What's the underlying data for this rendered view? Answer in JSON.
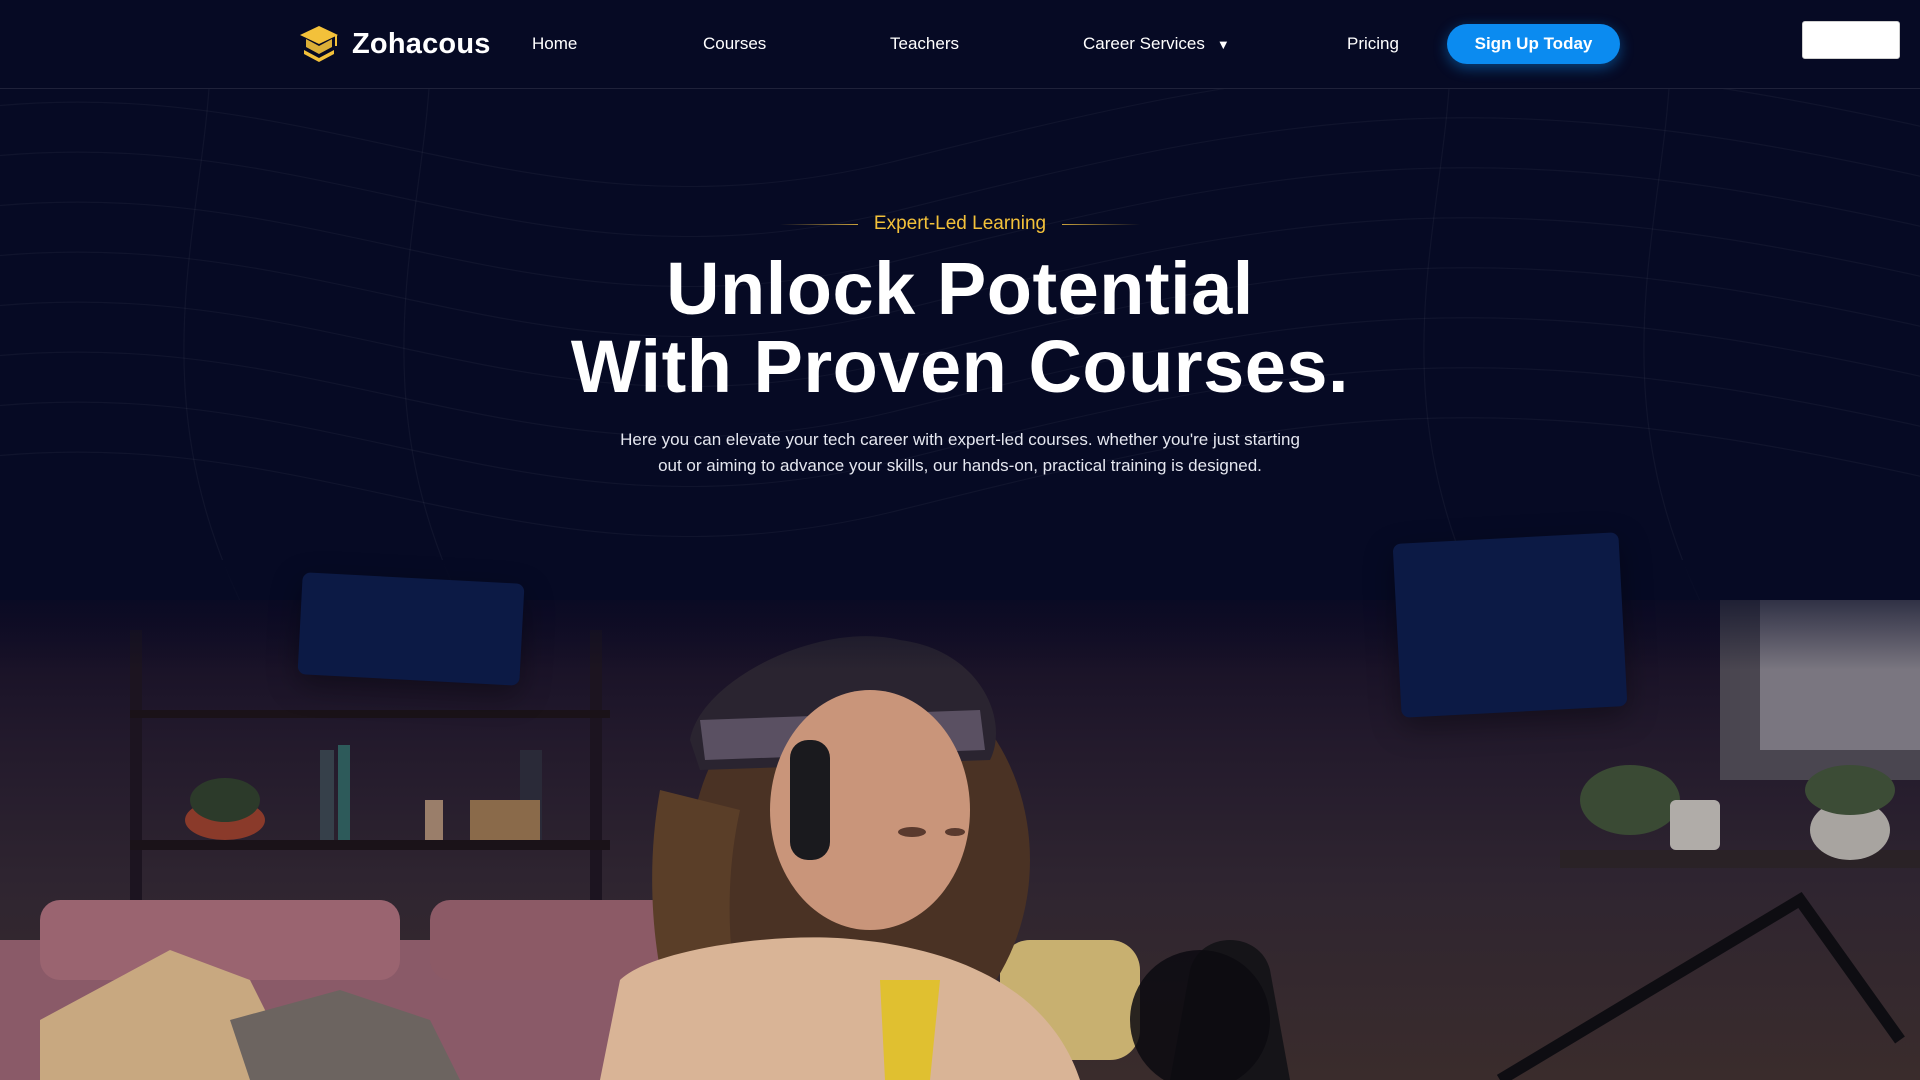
{
  "brand": {
    "name": "Zohacous",
    "logo_icon": "graduation-cap-icon",
    "accent": "#f3c13a"
  },
  "nav": {
    "items": [
      {
        "label": "Home"
      },
      {
        "label": "Courses"
      },
      {
        "label": "Teachers"
      },
      {
        "label": "Career Services",
        "has_dropdown": true,
        "caret": "▼"
      },
      {
        "label": "Pricing"
      }
    ],
    "cta_label": "Sign Up Today",
    "cta_color": "#0b8bf0"
  },
  "hero": {
    "eyebrow": "Expert-Led Learning",
    "headline_line1": "Unlock Potential",
    "headline_line2": "With Proven Courses.",
    "subtext_line1": "Here you can elevate your tech career with expert-led courses. whether you're just starting",
    "subtext_line2": "out or aiming to advance your skills, our hands-on, practical training is designed."
  },
  "colors": {
    "background": "#060a24",
    "card": "#0c1a45",
    "eyebrow": "#f3c13a"
  }
}
